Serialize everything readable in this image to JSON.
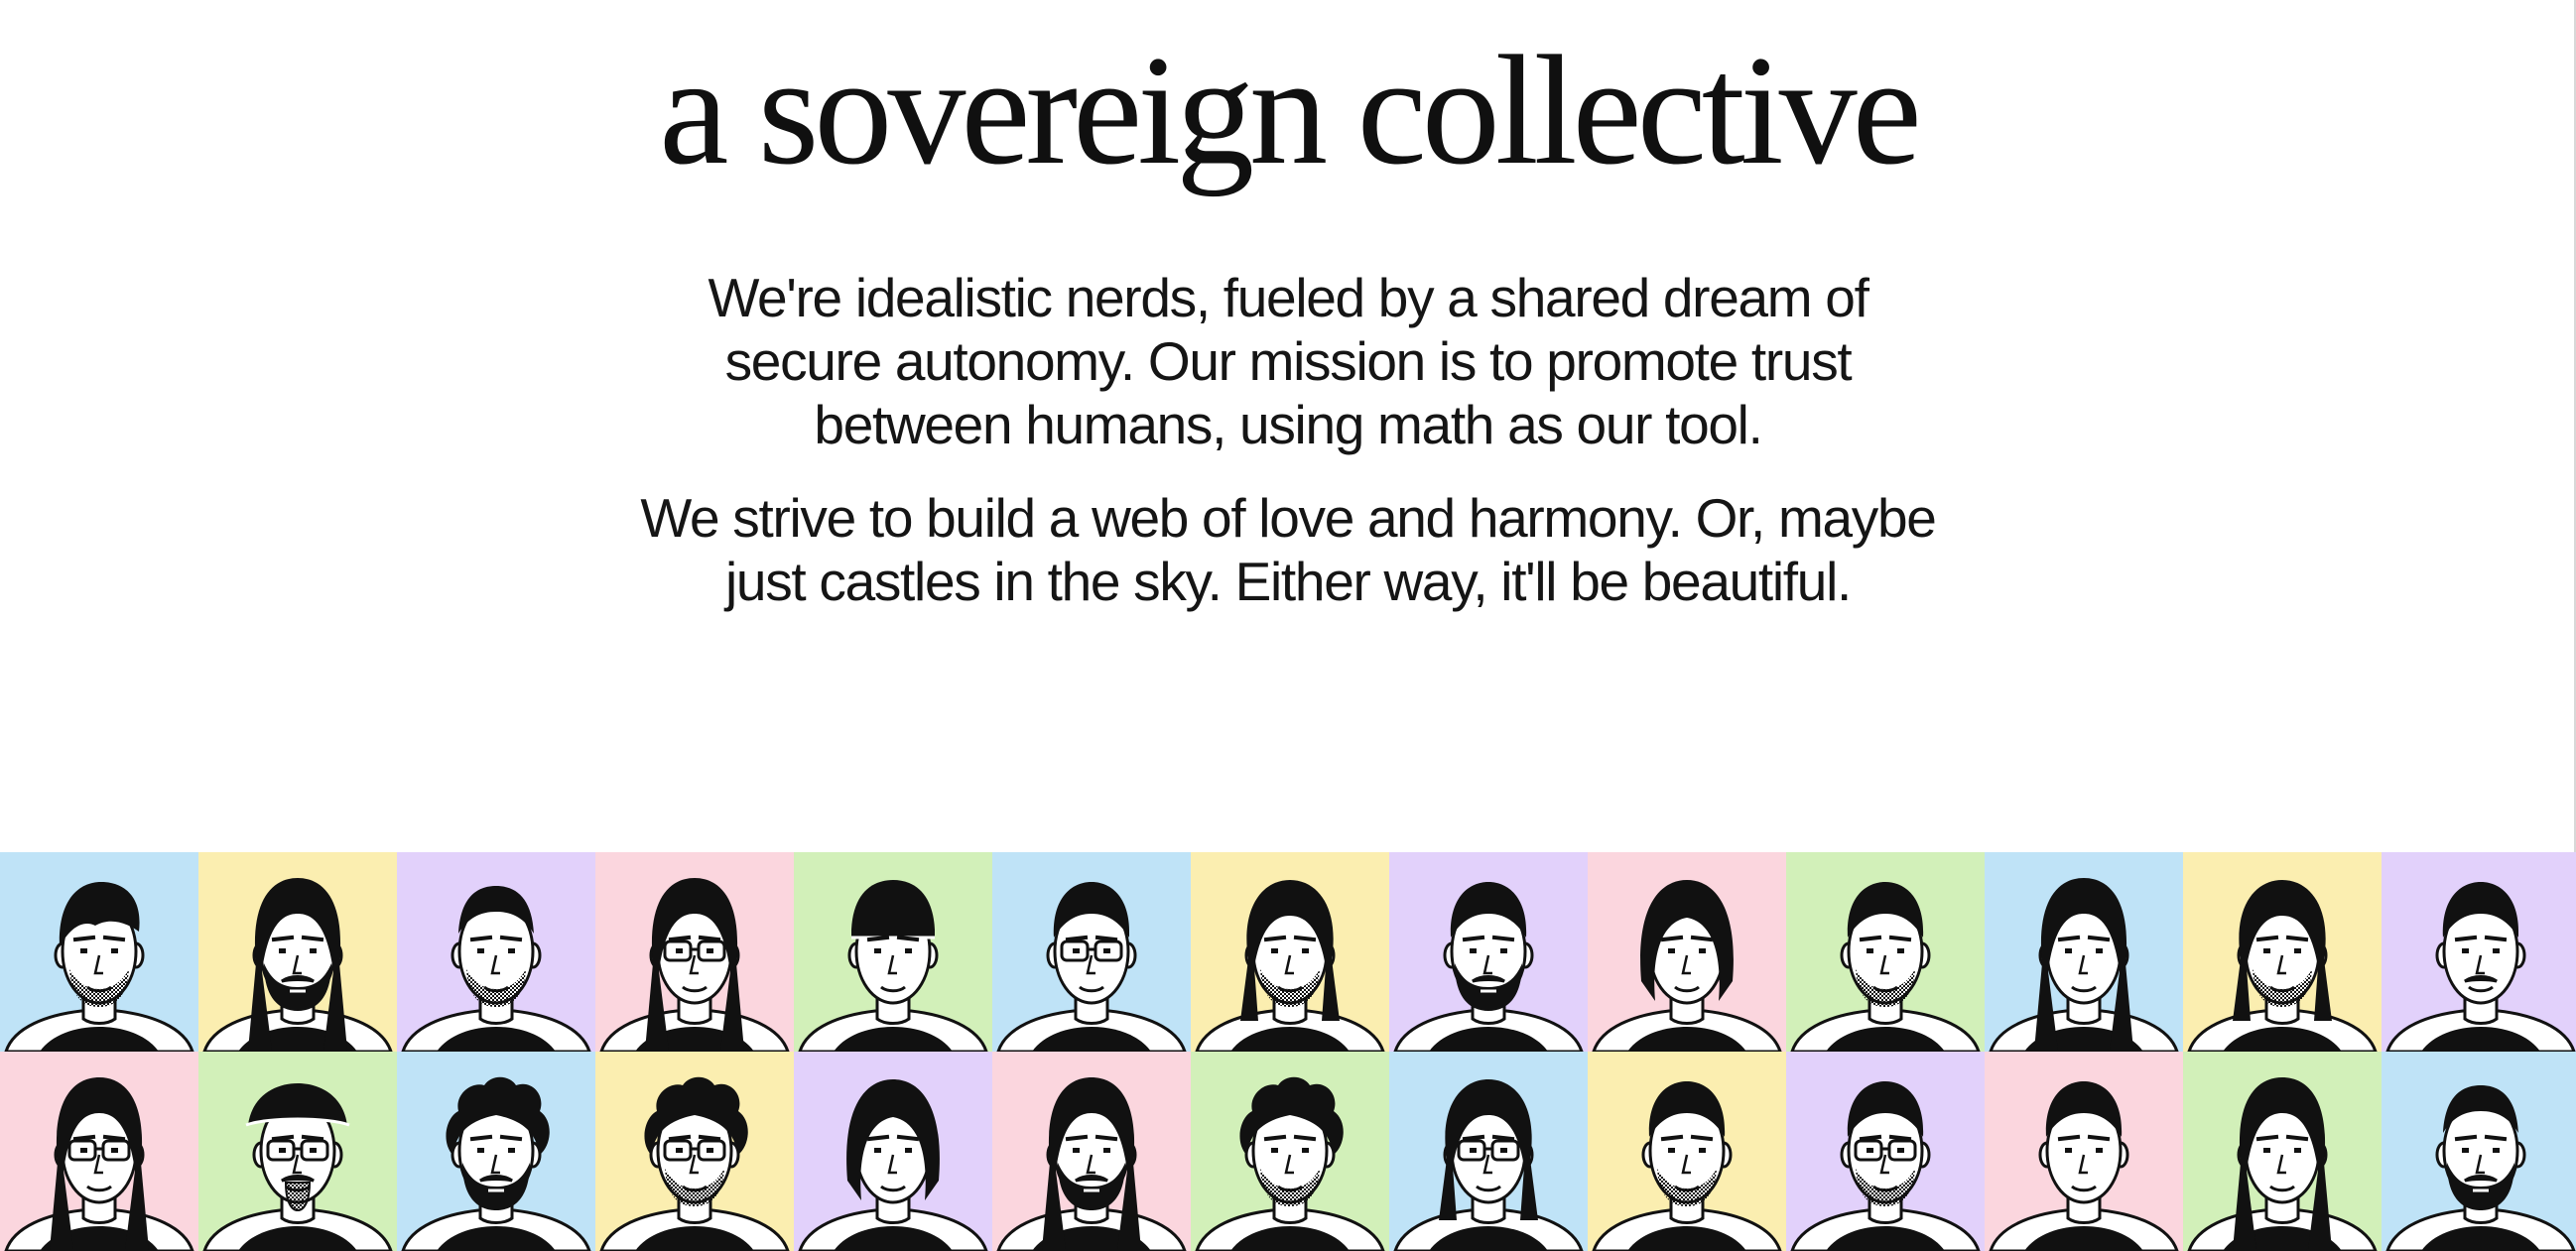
{
  "headline": "a sovereign collective",
  "paragraphs": [
    "We're idealistic nerds, fueled by a shared dream of secure autonomy. Our mission is to promote trust between humans, using math as our tool.",
    "We strive to build a web of love and harmony. Or, maybe just castles in the sky. Either way, it'll be beautiful."
  ],
  "palette": {
    "blue": "#bfe3f7",
    "yellow": "#fbeeb0",
    "purple": "#e2d1fb",
    "pink": "#fbd6de",
    "green": "#d2f0b9"
  },
  "team_grid": {
    "rows": [
      [
        {
          "bg": "blue",
          "hair": "swept",
          "glasses": false,
          "beard": "stubble"
        },
        {
          "bg": "yellow",
          "hair": "long",
          "glasses": false,
          "beard": "full"
        },
        {
          "bg": "purple",
          "hair": "buzz",
          "glasses": false,
          "beard": "stubble"
        },
        {
          "bg": "pink",
          "hair": "long",
          "glasses": true,
          "beard": "none"
        },
        {
          "bg": "green",
          "hair": "cap",
          "glasses": false,
          "beard": "none"
        },
        {
          "bg": "blue",
          "hair": "short",
          "glasses": true,
          "beard": "none"
        },
        {
          "bg": "yellow",
          "hair": "wavy",
          "glasses": false,
          "beard": "stubble"
        },
        {
          "bg": "purple",
          "hair": "short",
          "glasses": false,
          "beard": "full"
        },
        {
          "bg": "pink",
          "hair": "bob",
          "glasses": false,
          "beard": "none"
        },
        {
          "bg": "green",
          "hair": "short",
          "glasses": false,
          "beard": "stubble"
        },
        {
          "bg": "blue",
          "hair": "long",
          "glasses": false,
          "beard": "none"
        },
        {
          "bg": "yellow",
          "hair": "wavy",
          "glasses": false,
          "beard": "stubble"
        },
        {
          "bg": "purple",
          "hair": "short",
          "glasses": false,
          "beard": "mustache"
        }
      ],
      [
        {
          "bg": "pink",
          "hair": "long",
          "glasses": true,
          "beard": "none"
        },
        {
          "bg": "green",
          "hair": "flatcap",
          "glasses": true,
          "beard": "goatee"
        },
        {
          "bg": "blue",
          "hair": "curly",
          "glasses": false,
          "beard": "full"
        },
        {
          "bg": "yellow",
          "hair": "curly",
          "glasses": true,
          "beard": "stubble"
        },
        {
          "bg": "purple",
          "hair": "bob",
          "glasses": false,
          "beard": "none"
        },
        {
          "bg": "pink",
          "hair": "long",
          "glasses": false,
          "beard": "full"
        },
        {
          "bg": "green",
          "hair": "curly",
          "glasses": false,
          "beard": "stubble"
        },
        {
          "bg": "blue",
          "hair": "wavy",
          "glasses": true,
          "beard": "none"
        },
        {
          "bg": "yellow",
          "hair": "short",
          "glasses": false,
          "beard": "stubble"
        },
        {
          "bg": "purple",
          "hair": "short",
          "glasses": true,
          "beard": "stubble"
        },
        {
          "bg": "pink",
          "hair": "short",
          "glasses": false,
          "beard": "none"
        },
        {
          "bg": "green",
          "hair": "long",
          "glasses": false,
          "beard": "none"
        },
        {
          "bg": "blue",
          "hair": "buzz",
          "glasses": false,
          "beard": "full"
        }
      ]
    ]
  }
}
